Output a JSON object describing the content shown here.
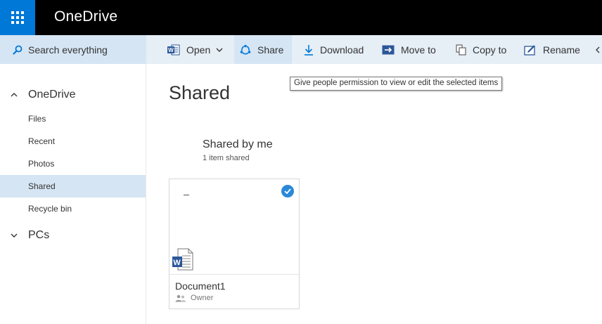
{
  "header": {
    "app_title": "OneDrive",
    "waffle_icon": "app-launcher-icon"
  },
  "commandbar": {
    "search_placeholder": "Search everything",
    "open_label": "Open",
    "share_label": "Share",
    "download_label": "Download",
    "move_label": "Move to",
    "copy_label": "Copy to",
    "rename_label": "Rename"
  },
  "tooltip": {
    "text": "Give people permission to view or edit the selected items"
  },
  "sidebar": {
    "onedrive_label": "OneDrive",
    "items": [
      {
        "label": "Files"
      },
      {
        "label": "Recent"
      },
      {
        "label": "Photos"
      },
      {
        "label": "Shared"
      },
      {
        "label": "Recycle bin"
      }
    ],
    "selected": "Shared",
    "pcs_label": "PCs"
  },
  "main": {
    "title": "Shared",
    "group_title": "Shared by me",
    "group_subtitle": "1 item shared",
    "files": [
      {
        "name": "Document1",
        "owner": "Owner",
        "type_icon": "word-document-icon",
        "selected": true
      }
    ]
  },
  "colors": {
    "brand_blue": "#0078d7",
    "topbar": "#000000",
    "command_bar": "#e6eef6",
    "selected_bg": "#d5e5f4",
    "check_blue": "#2b88d8",
    "word_blue": "#2b579a"
  }
}
